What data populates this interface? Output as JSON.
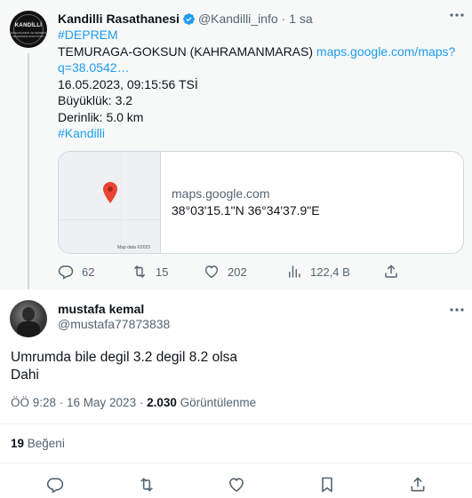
{
  "tweet1": {
    "author_name": "Kandilli Rasathanesi",
    "handle": "@Kandilli_info",
    "time": "· 1 sa",
    "avatar_text": "KANDİLLİ",
    "avatar_subtext": "RASATHANESİ VE DEPREM ARAŞTIRMA ENSTİTÜSÜ",
    "hashtag_top": "#DEPREM",
    "location_prefix": "TEMURAGA-GOKSUN (KAHRAMANMARAS)",
    "map_link_part1": "maps.google.com/maps?",
    "map_link_part2": "q=38.0542…",
    "datetime": "16.05.2023, 09:15:56 TSİ",
    "magnitude": "Büyüklük: 3.2",
    "depth": "Derinlik: 5.0 km",
    "hashtag_bottom": "#Kandilli",
    "card": {
      "domain": "maps.google.com",
      "coords": "38°03'15.1\"N 36°34'37.9\"E",
      "map_attribution": "Map data ©2023"
    },
    "actions": {
      "replies": "62",
      "retweets": "15",
      "likes": "202",
      "views": "122,4 B"
    }
  },
  "tweet2": {
    "author_name": "mustafa kemal",
    "handle": "@mustafa77873838",
    "text_line1": "Umrumda bile degil 3.2 degil 8.2 olsa",
    "text_line2": "Dahi",
    "meta_time": "ÖÖ 9:28 · 16 May 2023 · ",
    "views_count": "2.030",
    "views_label": " Görüntülenme",
    "likes_count": "19",
    "likes_label": " Beğeni"
  },
  "colors": {
    "accent": "#1d9bf0",
    "muted": "#536471",
    "text": "#0f1419",
    "pin": "#ea4335",
    "thread_bg": "#f7f9f9"
  },
  "icons": [
    "verified-badge-icon",
    "more-icon",
    "reply-icon",
    "retweet-icon",
    "like-icon",
    "views-icon",
    "share-icon",
    "bookmark-icon",
    "map-pin-icon"
  ]
}
